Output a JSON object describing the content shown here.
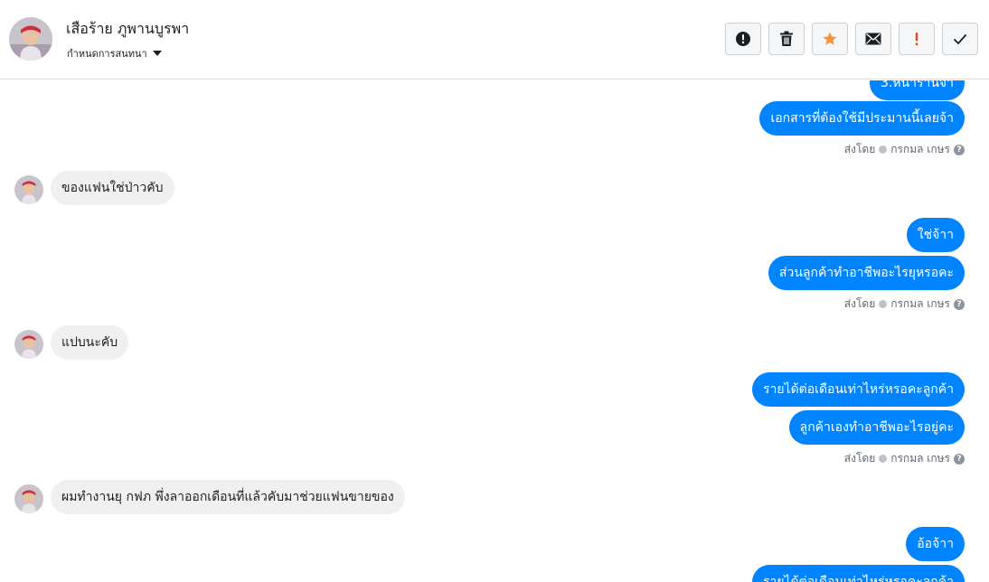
{
  "header": {
    "contact_name": "เสือร้าย ภูพานบูรพา",
    "conversation_settings": "กำหนดการสนทนา"
  },
  "toolbar": [
    {
      "name": "report-spam-button",
      "icon": "exclamation-circle-icon",
      "color": "#1c1e21"
    },
    {
      "name": "delete-button",
      "icon": "trash-icon",
      "color": "#1c1e21"
    },
    {
      "name": "star-button",
      "icon": "star-icon",
      "color": "#f7923b"
    },
    {
      "name": "mark-unread-button",
      "icon": "envelope-icon",
      "color": "#1c1e21"
    },
    {
      "name": "follow-up-button",
      "icon": "exclamation-icon",
      "color": "#e4462b"
    },
    {
      "name": "mark-done-button",
      "icon": "checkmark-icon",
      "color": "#1c1e21"
    }
  ],
  "thread": {
    "m0": "3.หน้าร้านจ้า",
    "m1": "เอกสารที่ต้องใช้มีประมานนี้เลยจ้า",
    "m2": "ของแฟนใช่ป่าวคับ",
    "m3": "ใช่จ้าา",
    "m4": "ส่วนลูกค้าทำอาชีพอะไรยุหรอคะ",
    "m5": "แปบนะคับ",
    "m6": "รายได้ต่อเดือนเท่าไหร่หรอคะลูกค้า",
    "m7": "ลูกค้าเองทำอาชีพอะไรอยู่คะ",
    "m8": "ผมทำงานยุ กฟภ พึ่งลาออกเดือนที่แล้วคับมาช่วยแฟนขายของ",
    "m9": "อ้อจ้าา",
    "m10": "รายได้ต่อเดือนเท่าไหร่หรอคะลูกค้า",
    "sent_by_label": "ส่งโดย",
    "agent_name": "กรกมล เกษร"
  },
  "colors": {
    "outgoing_bubble": "#0084ff",
    "incoming_bubble": "#f1f0f0"
  }
}
